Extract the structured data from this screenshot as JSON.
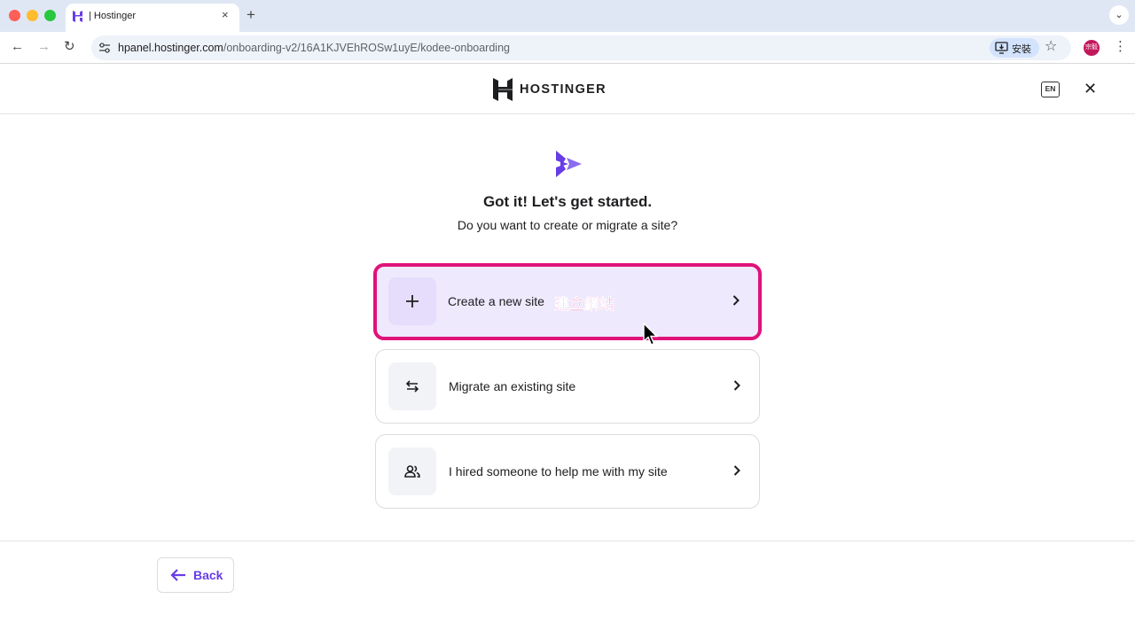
{
  "browser": {
    "tab_title": "| Hostinger",
    "tab_close": "×",
    "new_tab": "+",
    "tab_menu": "⌄",
    "nav_back": "←",
    "nav_forward": "→",
    "nav_reload": "↻",
    "url_host": "hpanel.hostinger.com",
    "url_path": "/onboarding-v2/16A1KJVEhROSw1uyE/kodee-onboarding",
    "install_label": "安裝",
    "bookmark_star": "☆",
    "profile_initials": "宗毅",
    "menu": "⋮"
  },
  "header": {
    "brand": "HOSTINGER",
    "language": "EN",
    "close": "✕"
  },
  "main": {
    "heading": "Got it! Let's get started.",
    "subheading": "Do you want to create or migrate a site?",
    "options": [
      {
        "label": "Create a new site",
        "icon": "plus-icon",
        "annotation": "建立網站",
        "selected": true
      },
      {
        "label": "Migrate an existing site",
        "icon": "swap-arrows-icon",
        "selected": false
      },
      {
        "label": "I hired someone to help me with my site",
        "icon": "people-icon",
        "selected": false
      }
    ]
  },
  "footer": {
    "back_label": "Back"
  },
  "colors": {
    "brand_purple": "#673de6",
    "highlight_pink": "#e0127a",
    "selected_bg": "#efe9fd"
  }
}
